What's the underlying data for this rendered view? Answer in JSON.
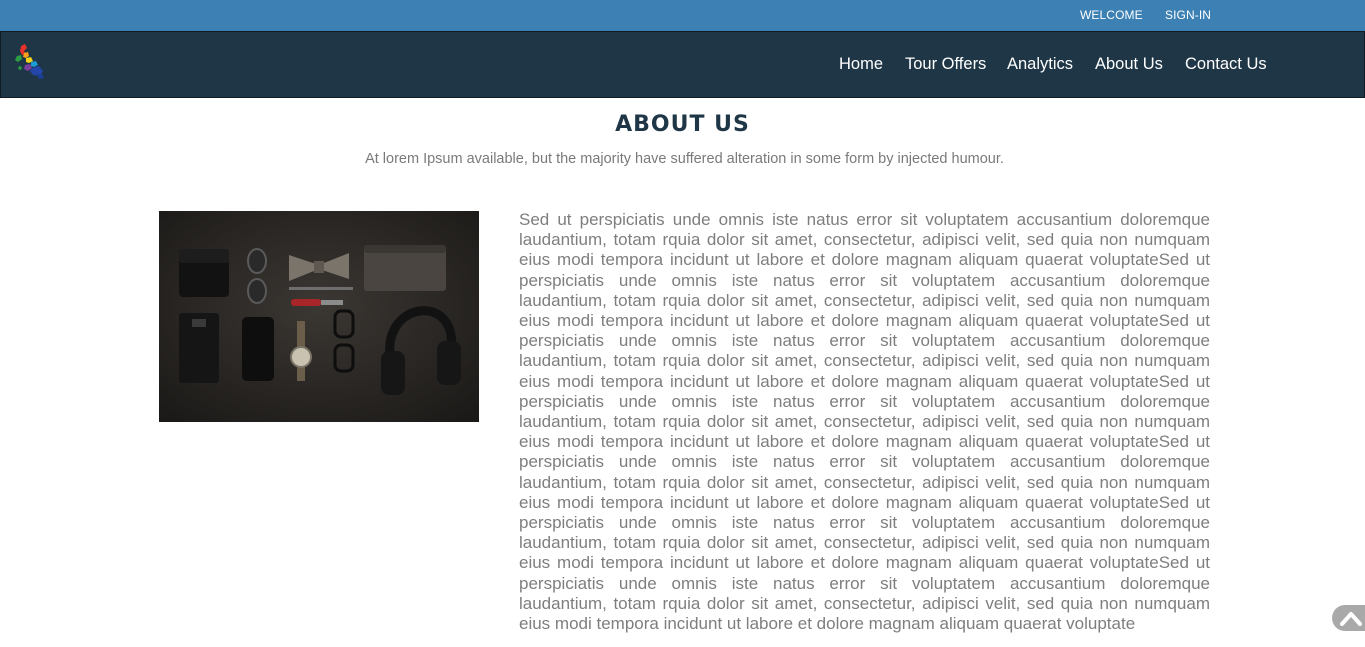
{
  "topbar": {
    "welcome": "WELCOME",
    "signin": "SIGN-IN"
  },
  "nav": {
    "logo_icon": "philippines-map-logo-icon",
    "items": [
      {
        "label": "Home"
      },
      {
        "label": "Tour Offers"
      },
      {
        "label": "Analytics"
      },
      {
        "label": "About Us"
      },
      {
        "label": "Contact Us"
      }
    ]
  },
  "main": {
    "title": "ABOUT US",
    "subtitle": "At lorem Ipsum available, but the majority have suffered alteration in some form by injected humour.",
    "body": "Sed ut perspiciatis unde omnis iste natus error sit voluptatem accusantium doloremque laudantium, totam rquia dolor sit amet, consectetur, adipisci velit, sed quia non numquam eius modi tempora incidunt ut labore et dolore magnam aliquam quaerat voluptateSed ut perspiciatis unde omnis iste natus error sit voluptatem accusantium doloremque laudantium, totam rquia dolor sit amet, consectetur, adipisci velit, sed quia non numquam eius modi tempora incidunt ut labore et dolore magnam aliquam quaerat voluptateSed ut perspiciatis unde omnis iste natus error sit voluptatem accusantium doloremque laudantium, totam rquia dolor sit amet, consectetur, adipisci velit, sed quia non numquam eius modi tempora incidunt ut labore et dolore magnam aliquam quaerat voluptateSed ut perspiciatis unde omnis iste natus error sit voluptatem accusantium doloremque laudantium, totam rquia dolor sit amet, consectetur, adipisci velit, sed quia non numquam eius modi tempora incidunt ut labore et dolore magnam aliquam quaerat voluptateSed ut perspiciatis unde omnis iste natus error sit voluptatem accusantium doloremque laudantium, totam rquia dolor sit amet, consectetur, adipisci velit, sed quia non numquam eius modi tempora incidunt ut labore et dolore magnam aliquam quaerat voluptateSed ut perspiciatis unde omnis iste natus error sit voluptatem accusantium doloremque laudantium, totam rquia dolor sit amet, consectetur, adipisci velit, sed quia non numquam eius modi tempora incidunt ut labore et dolore magnam aliquam quaerat voluptateSed ut perspiciatis unde omnis iste natus error sit voluptatem accusantium doloremque laudantium, totam rquia dolor sit amet, consectetur, adipisci velit, sed quia non numquam eius modi tempora incidunt ut labore et dolore magnam aliquam quaerat voluptate"
  },
  "colors": {
    "topbar": "#3c80b4",
    "navbar": "#1e3646",
    "title": "#1e3646",
    "body_text": "#7e7e7e"
  },
  "scroll_top_icon": "chevron-up-icon"
}
